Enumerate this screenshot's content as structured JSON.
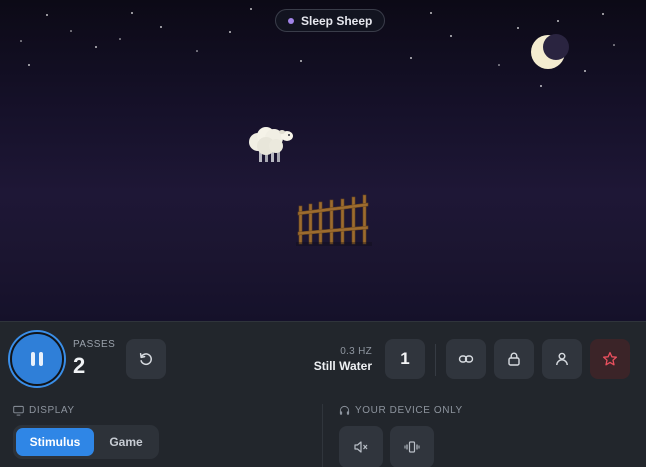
{
  "scene": {
    "title": "Sleep Sheep",
    "title_dot_color": "#a184e8"
  },
  "controls": {
    "play_state": "paused",
    "passes_label": "PASSES",
    "passes_value": "2",
    "frequency_label": "0.3 HZ",
    "sound_name": "Still Water",
    "count_value": "1",
    "accent_color": "#2f7fd8",
    "favorite_color": "#e9505e"
  },
  "display": {
    "label": "DISPLAY",
    "options": [
      "Stimulus",
      "Game"
    ],
    "selected": "Stimulus"
  },
  "device": {
    "label": "YOUR DEVICE ONLY"
  },
  "icons": {
    "play": "pause-icon",
    "restart": "restart-icon",
    "link": "link-icon",
    "lock": "lock-icon",
    "user": "user-icon",
    "favorite": "star-icon",
    "display": "monitor-icon",
    "device": "headphones-icon",
    "mute": "speaker-mute-icon",
    "vibrate": "vibrate-icon"
  }
}
